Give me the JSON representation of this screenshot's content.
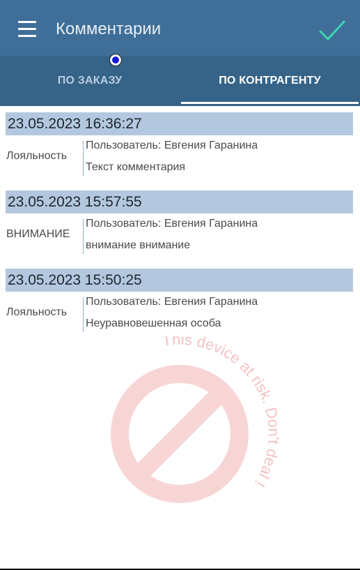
{
  "header": {
    "title": "Комментарии"
  },
  "tabs": [
    {
      "label": "ПО ЗАКАЗУ",
      "active": false
    },
    {
      "label": "ПО КОНТРАГЕНТУ",
      "active": true
    }
  ],
  "comments": [
    {
      "date": "23.05.2023 16:36:27",
      "type": "Лояльность",
      "user": "Пользователь: Евгения Гаранина",
      "text": "Текст комментария"
    },
    {
      "date": "23.05.2023 15:57:55",
      "type": "ВНИМАНИЕ",
      "user": "Пользователь: Евгения Гаранина",
      "text": "внимание внимание"
    },
    {
      "date": "23.05.2023 15:50:25",
      "type": "Лояльность",
      "user": "Пользователь: Евгения Гаранина",
      "text": "Неуравновешенная особа"
    }
  ],
  "watermark": {
    "text": "This device at risk. Don't deal !"
  },
  "colors": {
    "appbar": "#3f6f99",
    "tabbar": "#366488",
    "date_band": "#b3c8de",
    "confirm": "#3ed6b4",
    "watermark": "#f3b3b3"
  },
  "icons": {
    "menu": "hamburger-menu-icon",
    "confirm": "checkmark-icon",
    "watermark": "prohibited-sign-icon"
  }
}
